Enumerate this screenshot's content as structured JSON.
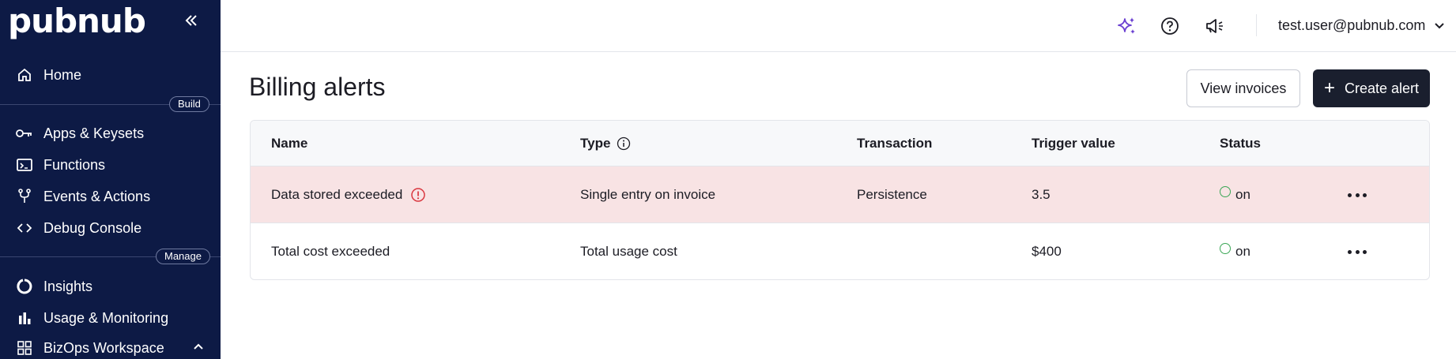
{
  "brand": {
    "logo_text": "pubnub"
  },
  "sidebar": {
    "collapse_icon": "double-chevron-left-icon",
    "sections": {
      "build": "Build",
      "manage": "Manage"
    },
    "items": [
      {
        "label": "Home",
        "icon": "home-icon"
      },
      {
        "label": "Apps & Keysets",
        "icon": "key-icon"
      },
      {
        "label": "Functions",
        "icon": "terminal-icon"
      },
      {
        "label": "Events & Actions",
        "icon": "fork-icon"
      },
      {
        "label": "Debug Console",
        "icon": "code-icon"
      },
      {
        "label": "Insights",
        "icon": "donut-icon"
      },
      {
        "label": "Usage & Monitoring",
        "icon": "bar-chart-icon"
      },
      {
        "label": "BizOps Workspace",
        "icon": "grid-icon"
      }
    ]
  },
  "topbar": {
    "icons": [
      "sparkle-icon",
      "help-icon",
      "announcement-icon"
    ],
    "user_email": "test.user@pubnub.com"
  },
  "main": {
    "title": "Billing alerts",
    "view_invoices_label": "View invoices",
    "create_alert_label": "Create alert",
    "table": {
      "headers": {
        "name": "Name",
        "type": "Type",
        "transaction": "Transaction",
        "trigger": "Trigger value",
        "status": "Status"
      },
      "rows": [
        {
          "name": "Data stored exceeded",
          "type": "Single entry on invoice",
          "transaction": "Persistence",
          "trigger": "3.5",
          "status": "on",
          "highlighted": true
        },
        {
          "name": "Total cost exceeded",
          "type": "Total usage cost",
          "transaction": "",
          "trigger": "$400",
          "status": "on",
          "highlighted": false
        }
      ]
    }
  },
  "colors": {
    "sidebar_bg": "#0d1a45",
    "alert_row_bg": "#f8e3e4",
    "status_on": "#3aa655",
    "warning_red": "#d9363e",
    "sparkle_purple": "#6a3fd1",
    "primary_button": "#1a1f2e"
  }
}
